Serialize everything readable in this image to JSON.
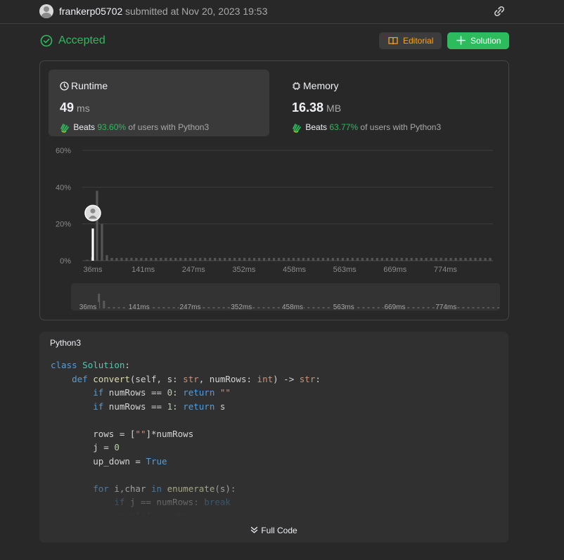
{
  "header": {
    "username": "frankerp05702",
    "submitted": "submitted at Nov 20, 2023 19:53",
    "link_icon": "link-icon"
  },
  "status": {
    "text": "Accepted",
    "color": "#2cbb5d"
  },
  "buttons": {
    "editorial": "Editorial",
    "solution": "Solution"
  },
  "runtime": {
    "title": "Runtime",
    "value": "49",
    "unit": "ms",
    "beats_label": "Beats",
    "beats_pct": "93.60%",
    "beats_suffix": "of users with Python3"
  },
  "memory": {
    "title": "Memory",
    "value": "16.38",
    "unit": "MB",
    "beats_label": "Beats",
    "beats_pct": "63.77%",
    "beats_suffix": "of users with Python3"
  },
  "chart_data": {
    "type": "bar",
    "ylim": [
      0,
      60
    ],
    "yticks": [
      "60%",
      "40%",
      "20%",
      "0%"
    ],
    "xticks": [
      "36ms",
      "141ms",
      "247ms",
      "352ms",
      "458ms",
      "563ms",
      "669ms",
      "774ms"
    ],
    "values": [
      0.5,
      2,
      38,
      20,
      3,
      1.5,
      1.5,
      1.5,
      1.5,
      1.5,
      1.5,
      1.5,
      1.5,
      1.5,
      1.5,
      1.5,
      1.5,
      1.5,
      1.5,
      1.5,
      1.5,
      1.5,
      1.5,
      1.5,
      1.5,
      1.5,
      1.5,
      1.5,
      1.5,
      1.5,
      1.5,
      1.5,
      1.5,
      1.5,
      1.5,
      1.5,
      1.5,
      1.5,
      1.5,
      1.5,
      1.5,
      1.5,
      1.5,
      1.5,
      1.5,
      1.5,
      1.5,
      1.5,
      1.5,
      1.5,
      1.5,
      1.5,
      1.5,
      1.5,
      1.5,
      1.5,
      1.5,
      1.5,
      1.5,
      1.5,
      1.5,
      1.5,
      1.5,
      1.5,
      1.5,
      1.5,
      1.5,
      1.5,
      1.5,
      1.5,
      1.5,
      1.5,
      1.5,
      1.5,
      1.5,
      1.5,
      1.5,
      1.5,
      1.5,
      1.5,
      1.5,
      1.5,
      1.5
    ],
    "highlight_index": 1,
    "highlight_value": 17.5,
    "grid": true
  },
  "code": {
    "language": "Python3",
    "full_code_label": "Full Code"
  }
}
